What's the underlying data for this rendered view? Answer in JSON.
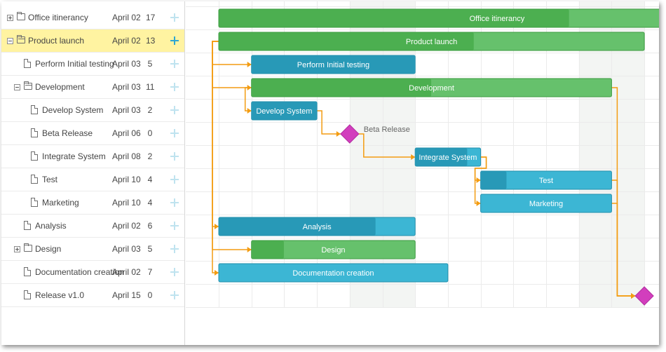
{
  "colors": {
    "project_done": "#4caf50",
    "project_rest": "#66c16c",
    "task_done": "#2899b7",
    "task_rest": "#3cb6d4",
    "milestone": "#d23ebd",
    "link": "#f39c12",
    "weekend": "#f3f5f3",
    "selected_row": "#fff3a1",
    "add_icon": "#bfe3ef"
  },
  "tasks": [
    {
      "id": 1,
      "name": "Office itinerancy",
      "start": "April 02",
      "duration": "17",
      "type": "project",
      "level": 0,
      "toggle": "plus",
      "icon": "folder-icon",
      "progress": 0.63
    },
    {
      "id": 2,
      "name": "Product launch",
      "start": "April 02",
      "duration": "13",
      "type": "project",
      "level": 0,
      "toggle": "minus",
      "icon": "folder-open-icon",
      "progress": 0.6,
      "selected": true
    },
    {
      "id": 3,
      "name": "Perform Initial testing",
      "start": "April 03",
      "duration": "5",
      "type": "task",
      "level": 1,
      "icon": "file-icon",
      "progress": 1.0
    },
    {
      "id": 4,
      "name": "Development",
      "start": "April 03",
      "duration": "11",
      "type": "project",
      "level": 1,
      "toggle": "minus",
      "icon": "folder-open-icon",
      "progress": 0.5
    },
    {
      "id": 5,
      "name": "Develop System",
      "start": "April 03",
      "duration": "2",
      "type": "task",
      "level": 2,
      "icon": "file-icon",
      "progress": 1.0
    },
    {
      "id": 6,
      "name": "Beta Release",
      "start": "April 06",
      "duration": "0",
      "type": "milestone",
      "level": 2,
      "icon": "file-icon"
    },
    {
      "id": 7,
      "name": "Integrate System",
      "start": "April 08",
      "duration": "2",
      "type": "task",
      "level": 2,
      "icon": "file-icon",
      "progress": 0.8
    },
    {
      "id": 8,
      "name": "Test",
      "start": "April 10",
      "duration": "4",
      "type": "task",
      "level": 2,
      "icon": "file-icon",
      "progress": 0.2
    },
    {
      "id": 9,
      "name": "Marketing",
      "start": "April 10",
      "duration": "4",
      "type": "task",
      "level": 2,
      "icon": "file-icon",
      "progress": 0.0
    },
    {
      "id": 10,
      "name": "Analysis",
      "start": "April 02",
      "duration": "6",
      "type": "task",
      "level": 1,
      "icon": "file-icon",
      "progress": 0.8
    },
    {
      "id": 11,
      "name": "Design",
      "start": "April 03",
      "duration": "5",
      "type": "project",
      "level": 1,
      "toggle": "plus",
      "icon": "folder-icon",
      "progress": 0.2
    },
    {
      "id": 12,
      "name": "Documentation creation",
      "start": "April 02",
      "duration": "7",
      "type": "task",
      "level": 1,
      "icon": "file-icon",
      "progress": 0.0
    },
    {
      "id": 13,
      "name": "Release v1.0",
      "start": "April 15",
      "duration": "0",
      "type": "milestone",
      "level": 1,
      "icon": "file-icon"
    }
  ],
  "links": [
    {
      "from": 2,
      "to": 3
    },
    {
      "from": 2,
      "to": 4
    },
    {
      "from": 2,
      "to": 10
    },
    {
      "from": 2,
      "to": 11
    },
    {
      "from": 2,
      "to": 12
    },
    {
      "from": 4,
      "to": 5
    },
    {
      "from": 5,
      "to": 6
    },
    {
      "from": 6,
      "to": 7
    },
    {
      "from": 7,
      "to": 8
    },
    {
      "from": 7,
      "to": 9
    },
    {
      "from": 4,
      "to": 13
    },
    {
      "from": 8,
      "to": 13
    },
    {
      "from": 9,
      "to": 13
    }
  ]
}
